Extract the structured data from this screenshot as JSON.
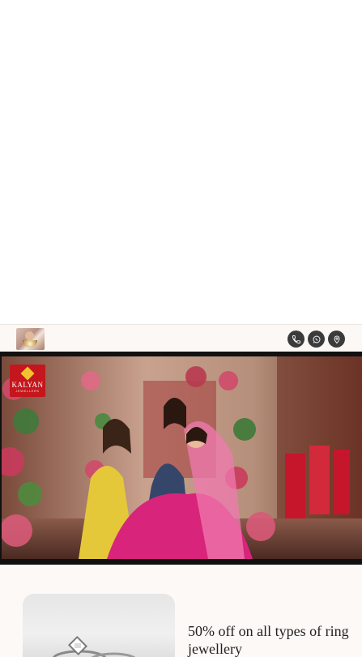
{
  "header": {
    "thumbnail_icon": "jewellery-model-thumbnail",
    "actions": [
      {
        "icon": "phone-icon"
      },
      {
        "icon": "whatsapp-icon"
      },
      {
        "icon": "location-pin-icon"
      }
    ]
  },
  "banner": {
    "brand_name": "KALYAN",
    "brand_sub": "JEWELLERS"
  },
  "offer": {
    "title": "50% off on all types of ring jewellery"
  },
  "colors": {
    "header_bg": "#fcf8f6",
    "icon_bg": "#3b3b3b",
    "brand_red": "#c4161c",
    "brand_gold": "#f2c230",
    "text_dark": "#222222"
  }
}
